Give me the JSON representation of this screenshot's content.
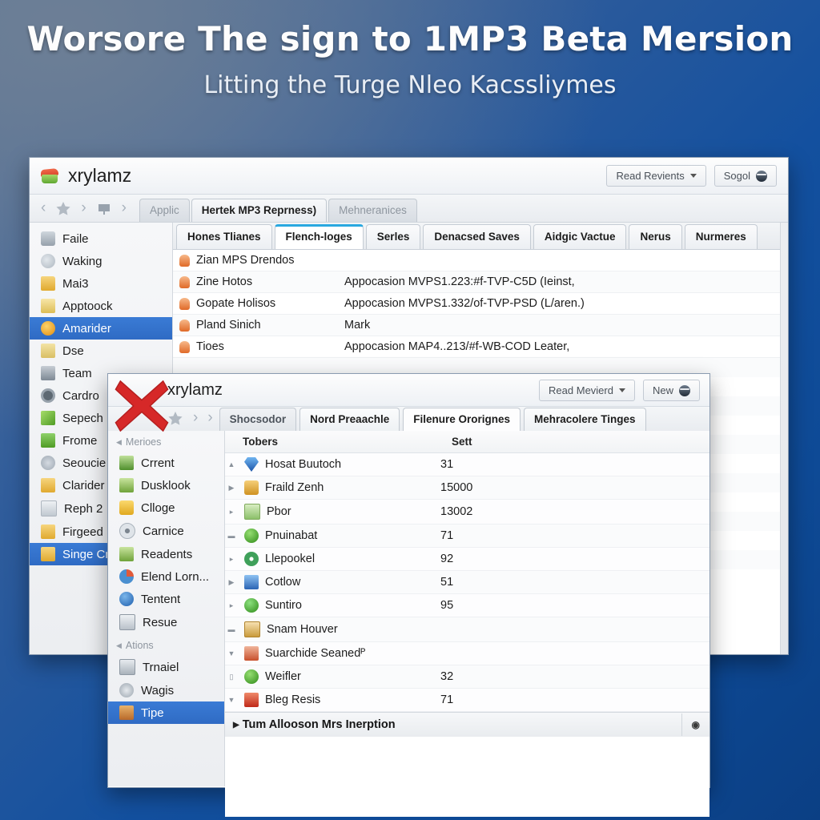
{
  "heading": {
    "title": "Worsore The sign to 1MP3 Beta Mersion",
    "subtitle": "Litting the Turge Nleo Kacssliymes"
  },
  "back_window": {
    "brand": "xrylamz",
    "brand_icon": "app-logo-icon",
    "buttons": [
      {
        "label": "Read Revients",
        "icon": "chevron-down-icon"
      },
      {
        "label": "Sogol",
        "icon": "globe-icon"
      }
    ],
    "nav": {
      "back": "back-arrow",
      "star": "favorites-star",
      "forward": "forward-arrow",
      "home": "home-icon",
      "more": "more-arrow"
    },
    "strip_tabs": [
      {
        "label": "Applic",
        "active": false
      },
      {
        "label": "Hertek MP3 Reprness)",
        "active": true
      },
      {
        "label": "Mehneranices",
        "active": false
      }
    ],
    "tabs": [
      {
        "label": "Hones Tlianes",
        "selected": false
      },
      {
        "label": "Flench-loges",
        "selected": true
      },
      {
        "label": "Serles",
        "selected": false
      },
      {
        "label": "Denacsed Saves",
        "selected": false
      },
      {
        "label": "Aidgic Vactue",
        "selected": false
      },
      {
        "label": "Nerus",
        "selected": false
      },
      {
        "label": "Nurmeres",
        "selected": false
      }
    ],
    "sidebar": [
      {
        "label": "Faile",
        "icon": "device-icon",
        "color": "#9aa3ad",
        "selected": false
      },
      {
        "label": "Waking",
        "icon": "cloud-icon",
        "color": "#b9bfc6",
        "selected": false
      },
      {
        "label": "Mai3",
        "icon": "folder-icon",
        "color": "#e8b84b",
        "selected": false
      },
      {
        "label": "Apptoock",
        "icon": "document-icon",
        "color": "#e5c76b",
        "selected": false
      },
      {
        "label": "Amarider",
        "icon": "user-badge-icon",
        "color": "#f0a81e",
        "selected": true
      },
      {
        "label": "Dse",
        "icon": "page-icon",
        "color": "#e3c979",
        "selected": false
      },
      {
        "label": "Team",
        "icon": "building-icon",
        "color": "#8e98a3",
        "selected": false
      },
      {
        "label": "Cardro",
        "icon": "gear-icon",
        "color": "#707a85",
        "selected": false
      },
      {
        "label": "Sepech",
        "icon": "pencil-icon",
        "color": "#7dc24b",
        "selected": false
      },
      {
        "label": "Frome",
        "icon": "download-icon",
        "color": "#66b24a",
        "selected": false
      },
      {
        "label": "Seoucie",
        "icon": "snowflake-icon",
        "color": "#aab3bc",
        "selected": false
      },
      {
        "label": "Clarider",
        "icon": "folder-info-icon",
        "color": "#e8b84b",
        "selected": false
      },
      {
        "label": "Reph 2",
        "icon": "list-icon",
        "color": "#b8c0c8",
        "selected": false
      },
      {
        "label": "Firgeed",
        "icon": "folder-icon",
        "color": "#e8b84b",
        "selected": false
      },
      {
        "label": "Singe Cm",
        "icon": "folder-open-icon",
        "color": "#e8b84b",
        "selected": true
      }
    ],
    "rows": [
      {
        "name": "Zian MPS Drendos",
        "value": "",
        "icon": "pin-icon"
      },
      {
        "name": "Zine Hotos",
        "value": "Appocasion MVPS1.223:#f-TVP-C5D (Ieinst,",
        "icon": "pin-icon"
      },
      {
        "name": "Gopate Holisos",
        "value": "Appocasion MVPS1.332/of-TVP-PSD (L/aren.)",
        "icon": "pin-icon"
      },
      {
        "name": "Pland Sinich",
        "value": "Mark",
        "icon": "pin-icon"
      },
      {
        "name": "Tioes",
        "value": "Appocasion MAP4..213/#f-WB-COD Leater,",
        "icon": "pin-icon"
      }
    ]
  },
  "front_window": {
    "brand": "xrylamz",
    "close_mark": "close-x-icon",
    "buttons": [
      {
        "label": "Read Mevierd",
        "icon": "chevron-down-icon"
      },
      {
        "label": "New",
        "icon": "globe-icon"
      }
    ],
    "tabs": [
      {
        "label": "Shocsodor",
        "selected": false
      },
      {
        "label": "Nord Preaachle",
        "selected": false
      },
      {
        "label": "Filenure Ororignes",
        "selected": true
      },
      {
        "label": "Mehracolere Tinges",
        "selected": false
      }
    ],
    "sidebar_groups": [
      {
        "title": "Merioes",
        "items": [
          {
            "label": "Crrent",
            "icon": "scanner-icon",
            "color": "#6aa84f",
            "selected": false
          },
          {
            "label": "Dusklook",
            "icon": "network-icon",
            "color": "#8ab44f",
            "selected": false
          },
          {
            "label": "Clloge",
            "icon": "note-icon",
            "color": "#f0c040",
            "selected": false
          },
          {
            "label": "Carnice",
            "icon": "disc-icon",
            "color": "#9aa3ad",
            "selected": false
          },
          {
            "label": "Readents",
            "icon": "network-icon",
            "color": "#8ab44f",
            "selected": false
          },
          {
            "label": "Elend Lorn...",
            "icon": "pie-chart-icon",
            "color": "#4a8fd0",
            "selected": false
          },
          {
            "label": "Tentent",
            "icon": "info-icon",
            "color": "#2d74c4",
            "selected": false
          },
          {
            "label": "Resue",
            "icon": "monitor-icon",
            "color": "#8e98a3",
            "selected": false
          }
        ]
      },
      {
        "title": "Ations",
        "items": [
          {
            "label": "Trnaiel",
            "icon": "book-icon",
            "color": "#9aa3ad",
            "selected": false
          },
          {
            "label": "Wagis",
            "icon": "power-icon",
            "color": "#a5aeb7",
            "selected": false
          },
          {
            "label": "Tipe",
            "icon": "toolbox-icon",
            "color": "#d08a3a",
            "selected": true
          }
        ]
      }
    ],
    "table": {
      "headers": [
        "Tobers",
        "Sett"
      ],
      "rows": [
        {
          "expander": "up",
          "name": "Hosat Buutoch",
          "value": "31",
          "icon": "gem-icon",
          "color": "#3b7fd4"
        },
        {
          "expander": "right",
          "name": "Fraild Zenh",
          "value": "15000",
          "icon": "medal-icon",
          "color": "#e0a53c"
        },
        {
          "expander": "small",
          "name": "Pbor",
          "value": "13002",
          "icon": "image-icon",
          "color": "#8cc06a"
        },
        {
          "expander": "dash",
          "name": "Pnuinabat",
          "value": "71",
          "icon": "leaf-icon",
          "color": "#4aa02c"
        },
        {
          "expander": "right",
          "name": "Llepookel",
          "value": "92",
          "icon": "clock-icon",
          "color": "#3fa05a"
        },
        {
          "expander": "right",
          "name": "Cotlow",
          "value": "51",
          "icon": "screen-icon",
          "color": "#3b82d4"
        },
        {
          "expander": "small",
          "name": "Suntiro",
          "value": "95",
          "icon": "phone-icon",
          "color": "#3fa05a"
        },
        {
          "expander": "dash",
          "name": "Snam Houver",
          "value": "",
          "icon": "card-icon",
          "color": "#d9a84c"
        },
        {
          "expander": "down",
          "name": "Suarchide Seanedᴾ",
          "value": "",
          "icon": "person-icon",
          "color": "#d06a4a"
        },
        {
          "expander": "page",
          "name": "Weifler",
          "value": "32",
          "icon": "shield-icon",
          "color": "#4aa02c"
        },
        {
          "expander": "down",
          "name": "Bleg Resis",
          "value": "71",
          "icon": "slides-icon",
          "color": "#d04a3a"
        }
      ],
      "status": {
        "label": "Tum Allooson Mrs Inerption",
        "expander": "right",
        "badge": "gear-icon"
      }
    }
  }
}
